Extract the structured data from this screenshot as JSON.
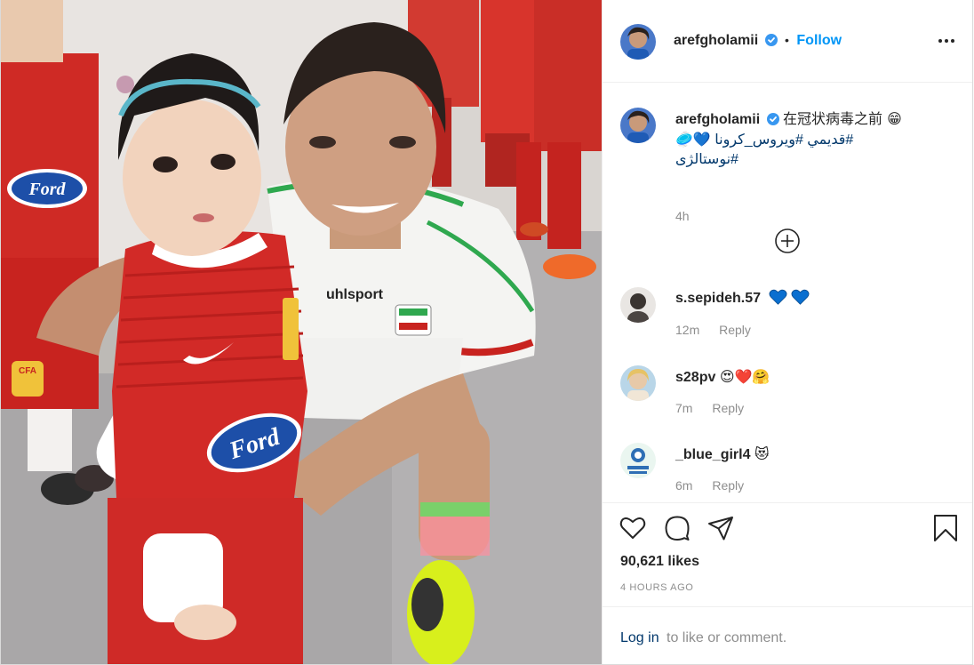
{
  "post": {
    "username": "arefgholamii",
    "follow_label": "Follow",
    "separator": "•",
    "caption_line1": "在冠状病毒之前 😁",
    "caption_line2": "#قديمي #ويروس_كرونا",
    "caption_line3": "#نوستالژی",
    "caption_time": "4h",
    "likes": "90,621 likes",
    "time_ago": "4 HOURS AGO",
    "photo_texts": {
      "ford_left": "Ford",
      "ford_center": "Ford",
      "uhlsport": "uhlsport",
      "cfa": "CFA"
    }
  },
  "comments": [
    {
      "username": "s.sepideh.57",
      "time": "12m",
      "reply": "Reply",
      "emojis": [
        "blue-heart",
        "blue-heart"
      ]
    },
    {
      "username": "s28pv",
      "text": "😍❤️🤗",
      "time": "7m",
      "reply": "Reply"
    },
    {
      "username": "_blue_girl4",
      "text": "😻",
      "time": "6m",
      "reply": "Reply"
    }
  ],
  "footer": {
    "login_link": "Log in",
    "login_rest": "to like or comment."
  },
  "icons": {
    "verified": "verified-badge-icon",
    "more": "more-options-icon",
    "add_comments": "plus-circle-icon",
    "like": "heart-outline-icon",
    "comment": "comment-bubble-icon",
    "share": "paper-plane-icon",
    "save": "bookmark-icon"
  },
  "colors": {
    "accent": "#0095f6",
    "link": "#00376b",
    "muted": "#8e8e8e",
    "verified": "#3897f0",
    "blue_heart": "#0a6fd0"
  }
}
